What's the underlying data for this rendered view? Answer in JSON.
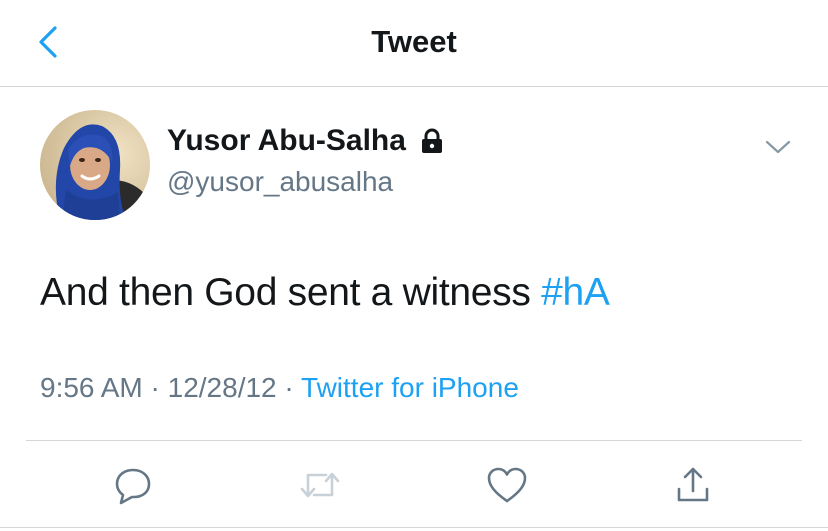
{
  "header": {
    "title": "Tweet",
    "back_icon": "chevron-left-icon"
  },
  "tweet": {
    "author": {
      "display_name": "Yusor Abu-Salha",
      "handle": "@yusor_abusalha",
      "protected_icon": "lock-icon"
    },
    "text": "And then God sent a witness",
    "hashtag": "#hA",
    "time": "9:56 AM",
    "date": "12/28/12",
    "source": "Twitter for iPhone",
    "separator": "·"
  },
  "actions": [
    {
      "name": "reply",
      "icon": "speech-bubble-icon"
    },
    {
      "name": "retweet",
      "icon": "retweet-icon",
      "disabled": true
    },
    {
      "name": "like",
      "icon": "heart-icon"
    },
    {
      "name": "share",
      "icon": "share-icon"
    }
  ],
  "colors": {
    "accent": "#1da1f2",
    "text": "#14171a",
    "secondary": "#657786",
    "divider": "#d6d6d6",
    "disabled": "#c8d1d8"
  }
}
